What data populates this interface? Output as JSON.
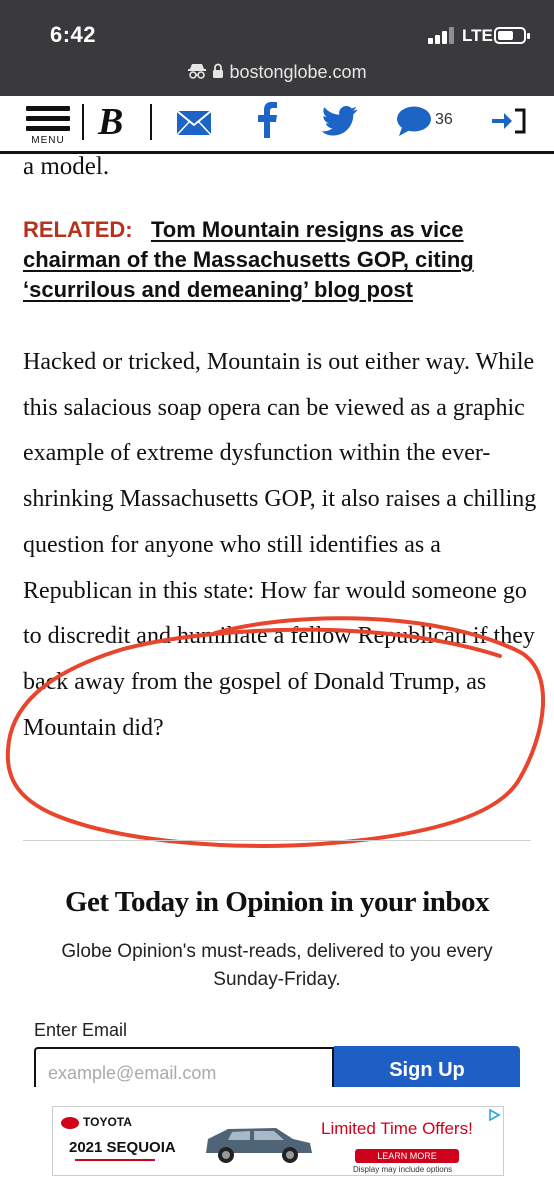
{
  "status_bar": {
    "time": "6:42",
    "network": "LTE"
  },
  "url_bar": {
    "domain": "bostonglobe.com"
  },
  "site_header": {
    "menu_label": "MENU",
    "logo": "B",
    "comments_count": "36"
  },
  "article": {
    "fragment": "a model.",
    "related_tag": "RELATED:",
    "related_link": "Tom Mountain resigns as vice chairman of the Massachusetts GOP, citing ‘scurrilous and demeaning’ blog post",
    "paragraph": "Hacked or tricked, Mountain is out either way. While this salacious soap opera can be viewed as a graphic example of extreme dysfunction within the ever-shrinking Massachusetts GOP, it also raises a chilling question for anyone who still identifies as a Republican in this state: How far would someone go to discredit and humiliate a fellow Republican if they back away from the gospel of Donald Trump, as Mountain did?"
  },
  "newsletter": {
    "title": "Get Today in Opinion in your inbox",
    "description": "Globe Opinion's must-reads, delivered to you every Sunday-Friday.",
    "email_label": "Enter Email",
    "email_placeholder": "example@email.com",
    "signup_label": "Sign Up"
  },
  "ad": {
    "brand": "TOYOTA",
    "model": "2021 SEQUOIA",
    "offer": "Limited Time Offers!",
    "button": "LEARN MORE",
    "disclaimer": "Display may include options"
  },
  "colors": {
    "status_bg": "#3a3a3c",
    "related_red": "#b5321e",
    "signup_blue": "#1e5fc6",
    "icon_blue": "#1d64c7",
    "annotation_red": "#e8452c"
  },
  "icons": [
    "menu-icon",
    "globe-logo",
    "mail-icon",
    "facebook-icon",
    "twitter-icon",
    "comment-icon",
    "login-icon",
    "lock-icon",
    "incognito-icon"
  ]
}
